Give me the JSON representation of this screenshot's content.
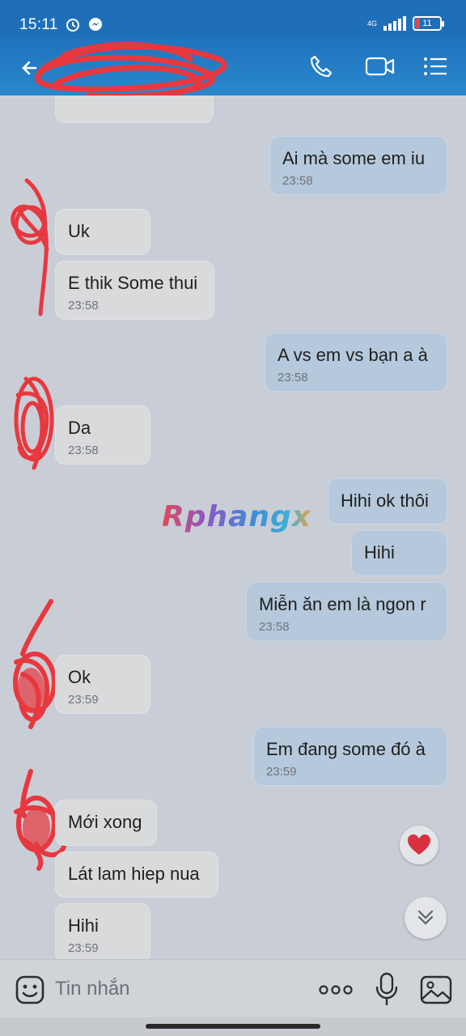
{
  "status": {
    "time": "15:11",
    "network": "4G",
    "battery": "11"
  },
  "header": {
    "back_icon": "arrow-left-icon",
    "call_icon": "phone-icon",
    "video_icon": "video-icon",
    "menu_icon": "menu-icon"
  },
  "watermark": "Rphangx",
  "messages": [
    {
      "dir": "out",
      "text": "Ai mà some em iu",
      "time": "23:58"
    },
    {
      "dir": "in",
      "text": "Uk",
      "time": ""
    },
    {
      "dir": "in",
      "text": "E thik Some thui",
      "time": "23:58"
    },
    {
      "dir": "out",
      "text": "A vs em vs bạn a à",
      "time": "23:58"
    },
    {
      "dir": "in",
      "text": "Da",
      "time": "23:58"
    },
    {
      "dir": "out",
      "text": "Hihi ok thôi",
      "time": ""
    },
    {
      "dir": "out",
      "text": "Hihi",
      "time": ""
    },
    {
      "dir": "out",
      "text": "Miễn ăn em là ngon r",
      "time": "23:58"
    },
    {
      "dir": "in",
      "text": "Ok",
      "time": "23:59"
    },
    {
      "dir": "out",
      "text": "Em đang some đó à",
      "time": "23:59"
    },
    {
      "dir": "in",
      "text": "Mới xong",
      "time": ""
    },
    {
      "dir": "in",
      "text": "Lát lam hiep nua",
      "time": ""
    },
    {
      "dir": "in",
      "text": "Hihi",
      "time": "23:59"
    }
  ],
  "composer": {
    "placeholder": "Tin nhắn"
  },
  "colors": {
    "header": "#1f74bd",
    "outgoing_bubble": "#b5c8dc",
    "incoming_bubble": "#d9dadc",
    "background": "#c9ced6"
  }
}
